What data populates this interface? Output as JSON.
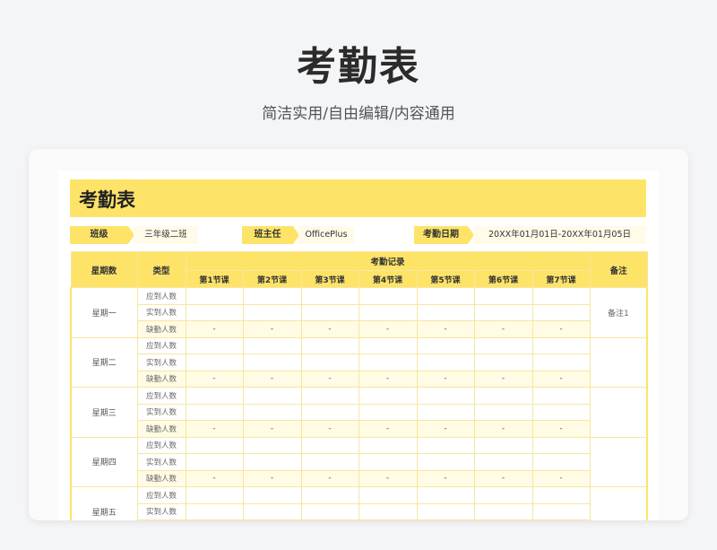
{
  "hero": {
    "title": "考勤表",
    "subtitle": "简洁实用/自由编辑/内容通用"
  },
  "sheet": {
    "title": "考勤表",
    "info": [
      {
        "label": "班级",
        "value": "三年级二班"
      },
      {
        "label": "班主任",
        "value": "OfficePlus"
      },
      {
        "label": "考勤日期",
        "value": "20XX年01月01日-20XX年01月05日"
      }
    ],
    "headers": {
      "day": "星期数",
      "type": "类型",
      "record": "考勤记录",
      "remark": "备注",
      "periods": [
        "第1节课",
        "第2节课",
        "第3节课",
        "第4节课",
        "第5节课",
        "第6节课",
        "第7节课"
      ]
    },
    "row_types": [
      "应到人数",
      "实到人数",
      "缺勤人数"
    ],
    "absent_placeholder": "-",
    "days": [
      {
        "name": "星期一",
        "remark": "备注1"
      },
      {
        "name": "星期二",
        "remark": ""
      },
      {
        "name": "星期三",
        "remark": ""
      },
      {
        "name": "星期四",
        "remark": ""
      },
      {
        "name": "星期五",
        "remark": ""
      }
    ]
  }
}
